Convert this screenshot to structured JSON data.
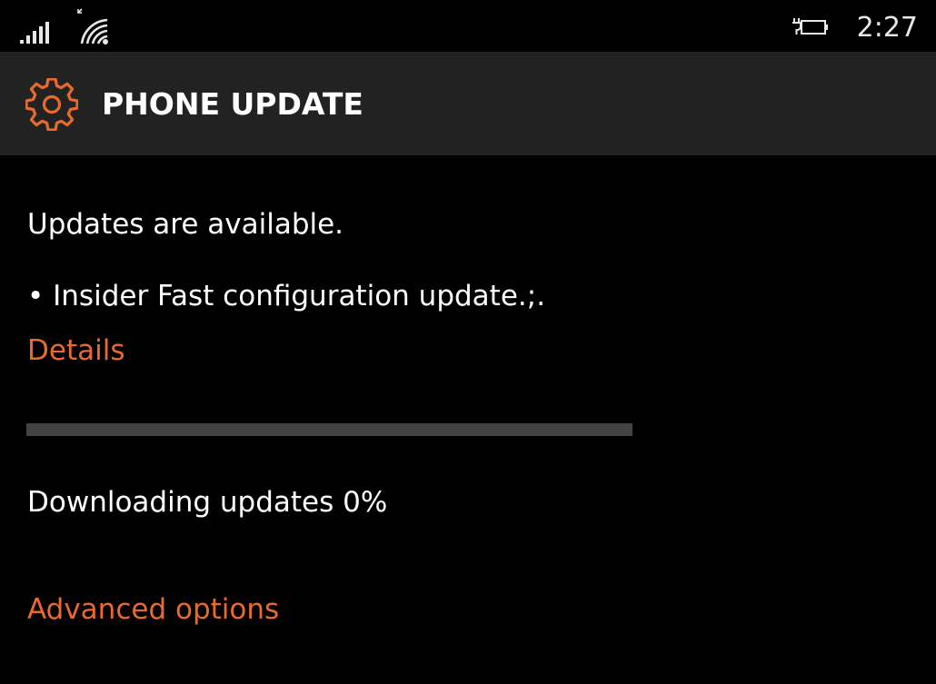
{
  "status_bar": {
    "time": "2:27",
    "icons": [
      "signal-strength-icon",
      "wifi-icon",
      "battery-charging-icon"
    ]
  },
  "header": {
    "icon": "gear-icon",
    "title": "PHONE UPDATE"
  },
  "main": {
    "status_message": "Updates are available.",
    "update_item": "• Insider Fast configuration update.;.",
    "details_link": "Details",
    "progress_fraction": 0,
    "download_status": "Downloading updates 0%",
    "advanced_options_link": "Advanced options"
  },
  "colors": {
    "accent": "#e86a2c",
    "background": "#000000",
    "header_background": "#222222",
    "progress_track": "#434343",
    "text": "#ffffff"
  }
}
